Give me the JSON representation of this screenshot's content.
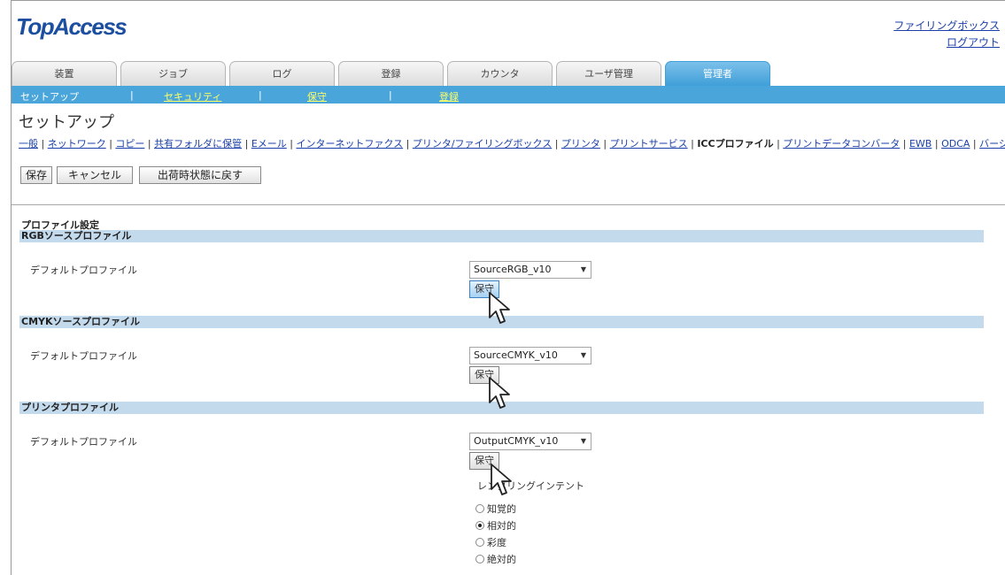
{
  "header": {
    "logo": "TopAccess",
    "filing_box_link": "ファイリングボックス",
    "logout_link": "ログアウト"
  },
  "tabs": [
    {
      "label": "装置"
    },
    {
      "label": "ジョブ"
    },
    {
      "label": "ログ"
    },
    {
      "label": "登録"
    },
    {
      "label": "カウンタ"
    },
    {
      "label": "ユーザ管理"
    },
    {
      "label": "管理者"
    }
  ],
  "subnav": {
    "items": [
      "セットアップ",
      "セキュリティ",
      "保守",
      "登録"
    ],
    "separator": "|"
  },
  "page_title": "セットアップ",
  "setting_links": [
    "一般",
    "ネットワーク",
    "コピー",
    "共有フォルダに保管",
    "Eメール",
    "インターネットファクス",
    "プリンタ/ファイリングボックス",
    "プリンタ",
    "プリントサービス",
    "ICCプロファイル",
    "プリントデータコンバータ",
    "EWB",
    "ODCA",
    "バージョン"
  ],
  "buttons": {
    "save": "保存",
    "cancel": "キャンセル",
    "reset": "出荷時状態に戻す"
  },
  "section_title": "プロファイル設定",
  "profiles": [
    {
      "band": "RGBソースプロファイル",
      "label": "デフォルトプロファイル",
      "value": "SourceRGB_v10",
      "button": "保守"
    },
    {
      "band": "CMYKソースプロファイル",
      "label": "デフォルトプロファイル",
      "value": "SourceCMYK_v10",
      "button": "保守"
    },
    {
      "band": "プリンタプロファイル",
      "label": "デフォルトプロファイル",
      "value": "OutputCMYK_v10",
      "button": "保守"
    }
  ],
  "rendering_intent": {
    "label": "レンダリングインテント",
    "options": [
      "知覚的",
      "相対的",
      "彩度",
      "絶対的"
    ],
    "selected": "相対的"
  },
  "colors": {
    "accent": "#4aa5da",
    "band": "#c3d9ec",
    "link": "#1a3fa8"
  }
}
